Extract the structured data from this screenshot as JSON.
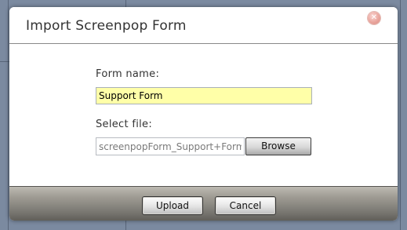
{
  "dialog": {
    "title": "Import Screenpop Form",
    "close_icon": "close-icon"
  },
  "form": {
    "form_name_label": "Form name:",
    "form_name_value": "Support Form",
    "select_file_label": "Select file:",
    "file_value": "screenpopForm_Support+Form",
    "browse_label": "Browse"
  },
  "footer": {
    "upload_label": "Upload",
    "cancel_label": "Cancel"
  },
  "colors": {
    "form_name_highlight": "#ffffa8",
    "footer_gradient_top": "#bdbab2",
    "footer_gradient_bottom": "#5e5c57"
  }
}
